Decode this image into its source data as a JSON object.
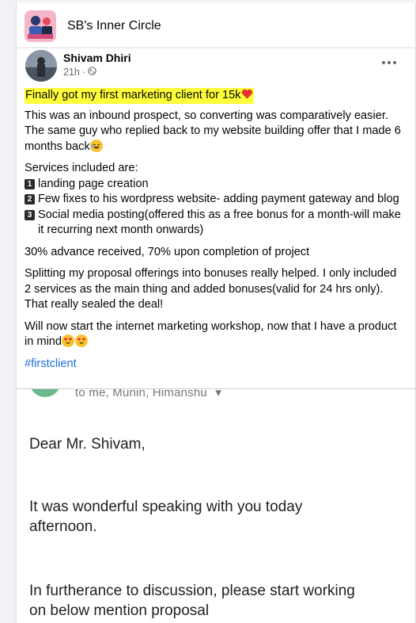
{
  "group": {
    "name": "SB's Inner Circle",
    "avatar_icon": "group-cover-icon"
  },
  "post": {
    "author": "Shivam Dhiri",
    "time": "21h",
    "privacy_icon": "globe-icon",
    "more_icon": "more-options-icon",
    "highlight_text": "Finally got my first marketing client for 15k",
    "highlight_color": "#ffff3a",
    "paragraph1": "This was an inbound prospect, so converting was comparatively easier. The same guy who replied back to my website building offer that I made 6 months back",
    "services_intro": "Services included are:",
    "services": [
      {
        "num": "1",
        "text": "landing page creation"
      },
      {
        "num": "2",
        "text": "Few fixes to his wordpress website- adding payment gateway and blog"
      },
      {
        "num": "3",
        "text": "Social media posting(offered this as a free bonus for a month-will make it recurring next month onwards)"
      }
    ],
    "payment": "30% advance received, 70% upon completion of project",
    "paragraph2": "Splitting my proposal offerings into bonuses really helped. I only included 2 services as the main thing and added bonuses(valid for 24 hrs only). That really sealed the deal!",
    "paragraph3": "Will now start the internet marketing workshop, now that I have a product in mind",
    "hashtag": "#firstclient",
    "hashtag_color": "#216fdb"
  },
  "email": {
    "recipients": "to me, Munin, Himanshu",
    "greeting": "Dear Mr. Shivam,",
    "line1": "It was wonderful speaking with you today",
    "line2": "afternoon.",
    "line3": "In furtherance to discussion, please start working",
    "line4": "on below mention proposal"
  }
}
